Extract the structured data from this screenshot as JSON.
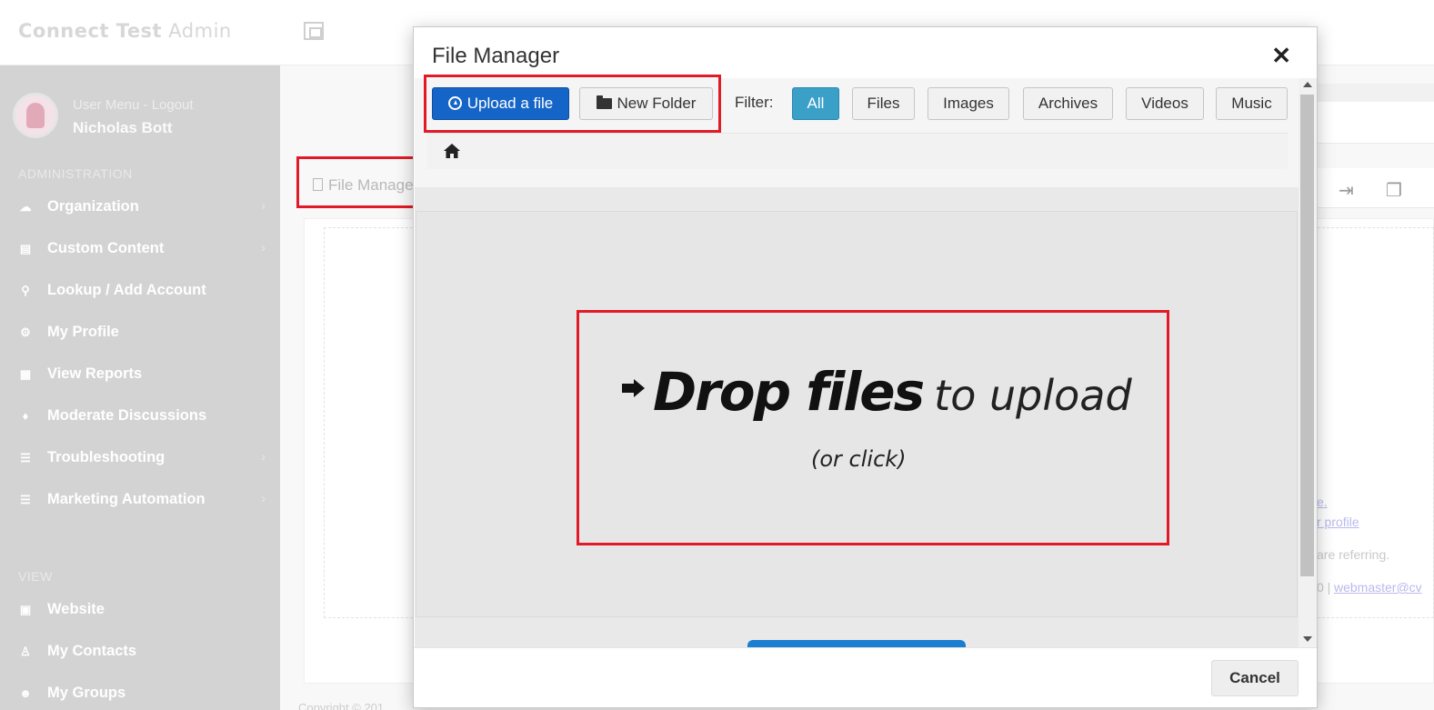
{
  "app": {
    "brand_bold": "Connect Test",
    "brand_light": " Admin"
  },
  "user": {
    "menu_label": "User Menu - Logout",
    "name": "Nicholas Bott"
  },
  "sidebar": {
    "section_admin": "ADMINISTRATION",
    "section_view": "VIEW",
    "items": [
      {
        "label": "Organization",
        "icon": "cloud-icon",
        "chevron": true
      },
      {
        "label": "Custom Content",
        "icon": "document-icon",
        "chevron": true
      },
      {
        "label": "Lookup / Add Account",
        "icon": "search-plus-icon",
        "chevron": false
      },
      {
        "label": "My Profile",
        "icon": "gear-icon",
        "chevron": false
      },
      {
        "label": "View Reports",
        "icon": "table-icon",
        "chevron": false
      },
      {
        "label": "Moderate Discussions",
        "icon": "thumbs-up-icon",
        "chevron": false
      },
      {
        "label": "Troubleshooting",
        "icon": "list-icon",
        "chevron": true
      },
      {
        "label": "Marketing Automation",
        "icon": "list-icon",
        "chevron": true
      }
    ],
    "view_items": [
      {
        "label": "Website",
        "icon": "film-icon"
      },
      {
        "label": "My Contacts",
        "icon": "person-icon"
      },
      {
        "label": "My Groups",
        "icon": "users-icon"
      }
    ]
  },
  "background": {
    "file_manager_tab": "File Manage",
    "footer_text": "Copyright © 201",
    "right_link_1": "e.",
    "right_link_2": "r profile",
    "right_text_1": "are referring.",
    "right_text_2": "0 | ",
    "right_link_3": "webmaster@cv"
  },
  "modal": {
    "title": "File Manager",
    "close_glyph": "✕",
    "upload_label": "Upload a file",
    "new_folder_label": "New Folder",
    "filter_label": "Filter:",
    "filters": [
      {
        "label": "All",
        "active": true
      },
      {
        "label": "Files",
        "active": false
      },
      {
        "label": "Images",
        "active": false
      },
      {
        "label": "Archives",
        "active": false
      },
      {
        "label": "Videos",
        "active": false
      },
      {
        "label": "Music",
        "active": false
      }
    ],
    "drop_big": "Drop files",
    "drop_small": "to upload",
    "drop_sub": "(or click)",
    "cancel_label": "Cancel"
  },
  "colors": {
    "highlight": "#e21a27",
    "primary": "#1565c8",
    "filter_active": "#3aa0c8",
    "sidebar_bg": "#d3d3d3"
  }
}
